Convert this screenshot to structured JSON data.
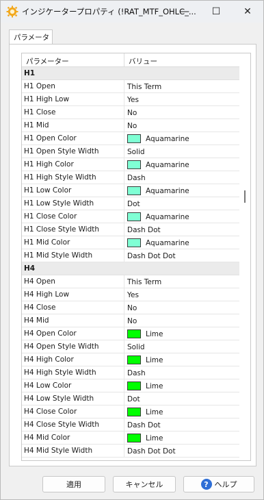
{
  "window": {
    "title": "インジケータープロパティ (!RAT_MTF_OHLC_...",
    "icon": "gear-sun-icon",
    "controls": {
      "minimize": "—",
      "maximize": "☐",
      "close": "✕"
    }
  },
  "tabs": [
    {
      "label": "パラメーター",
      "active": true
    }
  ],
  "grid": {
    "columns": {
      "name": "パラメーター",
      "value": "バリュー"
    },
    "rows": [
      {
        "type": "group",
        "name": "H1"
      },
      {
        "name": "H1 Open",
        "value": "This Term"
      },
      {
        "name": "H1 High Low",
        "value": "Yes"
      },
      {
        "name": "H1 Close",
        "value": "No"
      },
      {
        "name": "H1 Mid",
        "value": "No"
      },
      {
        "name": "H1 Open Color",
        "value": "Aquamarine",
        "color": "#7fffd4"
      },
      {
        "name": "H1 Open Style Width",
        "value": "Solid"
      },
      {
        "name": "H1 High Color",
        "value": "Aquamarine",
        "color": "#7fffd4"
      },
      {
        "name": "H1 High Style Width",
        "value": "Dash"
      },
      {
        "name": "H1 Low Color",
        "value": "Aquamarine",
        "color": "#7fffd4"
      },
      {
        "name": "H1 Low Style Width",
        "value": "Dot"
      },
      {
        "name": "H1 Close Color",
        "value": "Aquamarine",
        "color": "#7fffd4"
      },
      {
        "name": "H1 Close Style Width",
        "value": "Dash Dot"
      },
      {
        "name": "H1 Mid Color",
        "value": "Aquamarine",
        "color": "#7fffd4"
      },
      {
        "name": "H1 Mid Style Width",
        "value": "Dash Dot Dot"
      },
      {
        "type": "group",
        "name": "H4"
      },
      {
        "name": "H4 Open",
        "value": "This Term"
      },
      {
        "name": "H4 High Low",
        "value": "Yes"
      },
      {
        "name": "H4 Close",
        "value": "No"
      },
      {
        "name": "H4 Mid",
        "value": "No"
      },
      {
        "name": "H4 Open Color",
        "value": "Lime",
        "color": "#00ff00"
      },
      {
        "name": "H4 Open Style Width",
        "value": "Solid"
      },
      {
        "name": "H4 High Color",
        "value": "Lime",
        "color": "#00ff00"
      },
      {
        "name": "H4 High Style Width",
        "value": "Dash"
      },
      {
        "name": "H4 Low Color",
        "value": "Lime",
        "color": "#00ff00"
      },
      {
        "name": "H4 Low Style Width",
        "value": "Dot"
      },
      {
        "name": "H4 Close Color",
        "value": "Lime",
        "color": "#00ff00"
      },
      {
        "name": "H4 Close Style Width",
        "value": "Dash Dot"
      },
      {
        "name": "H4 Mid Color",
        "value": "Lime",
        "color": "#00ff00"
      },
      {
        "name": "H4 Mid Style Width",
        "value": "Dash Dot Dot"
      }
    ]
  },
  "buttons": {
    "apply": "適用",
    "cancel": "キャンセル",
    "help": "ヘルプ",
    "help_icon": "question-icon"
  }
}
